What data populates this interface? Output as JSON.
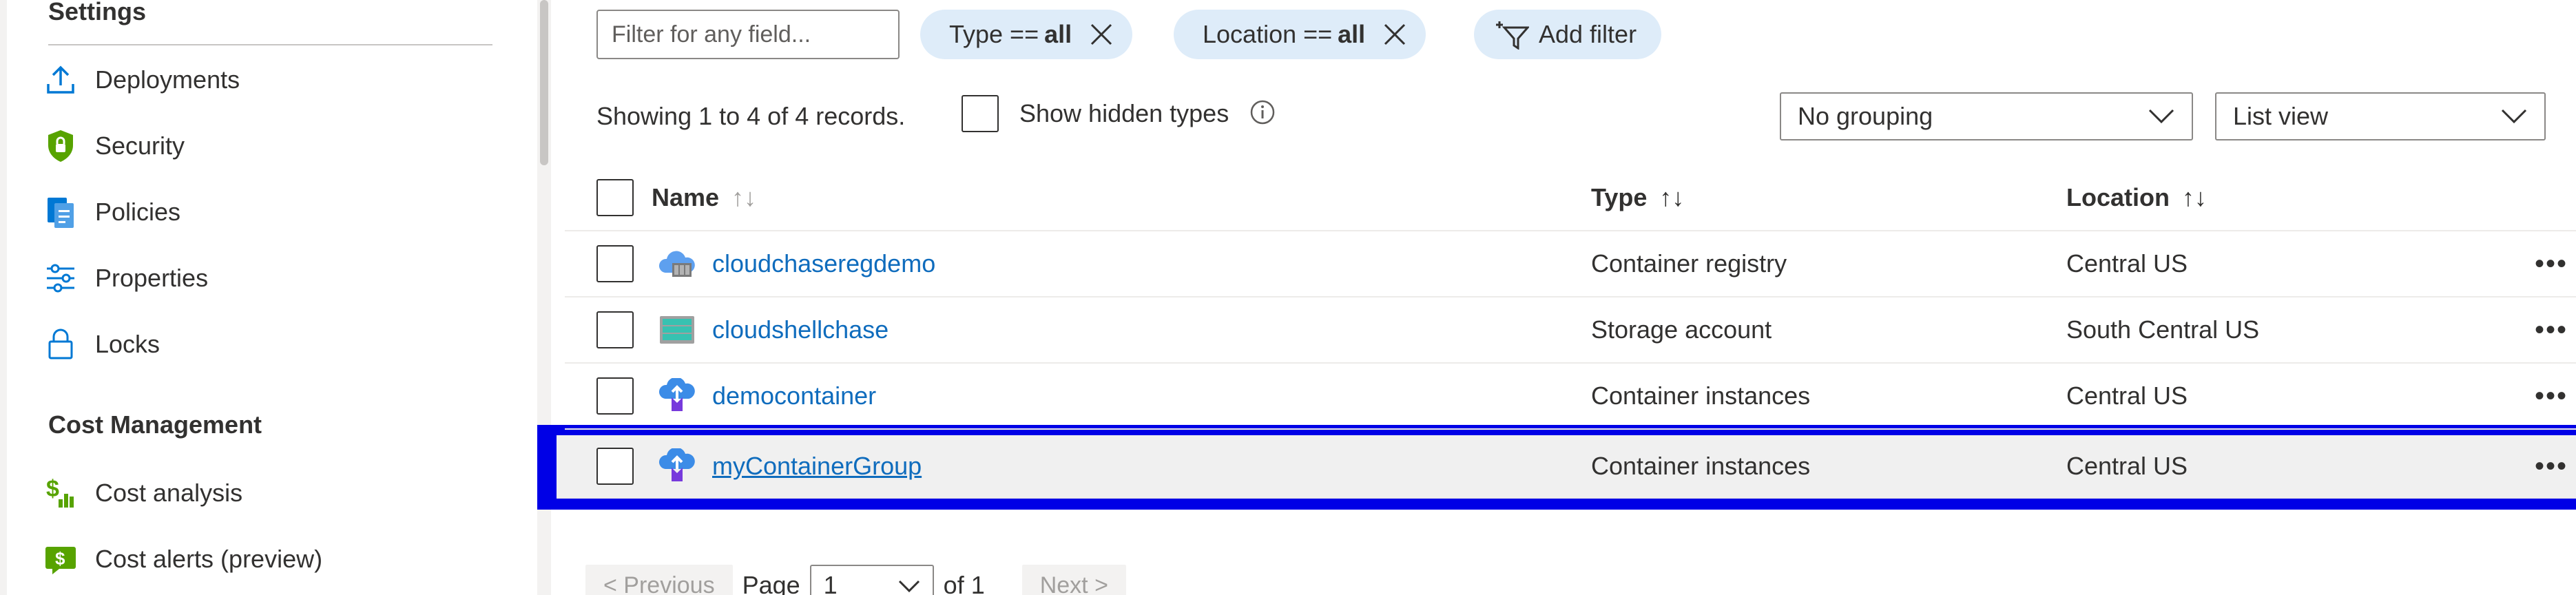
{
  "sidebar": {
    "settings_title": "Settings",
    "items": [
      {
        "label": "Deployments"
      },
      {
        "label": "Security"
      },
      {
        "label": "Policies"
      },
      {
        "label": "Properties"
      },
      {
        "label": "Locks"
      }
    ],
    "cost_title": "Cost Management",
    "cost_items": [
      {
        "label": "Cost analysis"
      },
      {
        "label": "Cost alerts (preview)"
      }
    ]
  },
  "toolbar": {
    "filter_placeholder": "Filter for any field...",
    "pill_type_prefix": "Type ==",
    "pill_type_value": "all",
    "pill_location_prefix": "Location ==",
    "pill_location_value": "all",
    "add_filter_label": "Add filter"
  },
  "records_text": "Showing 1 to 4 of 4 records.",
  "show_hidden_label": "Show hidden types",
  "grouping": {
    "selected": "No grouping"
  },
  "view": {
    "selected": "List view"
  },
  "table": {
    "headers": {
      "name": "Name",
      "type": "Type",
      "location": "Location"
    },
    "rows": [
      {
        "name": "cloudchaseregdemo",
        "type": "Container registry",
        "location": "Central US",
        "icon": "container-registry-icon"
      },
      {
        "name": "cloudshellchase",
        "type": "Storage account",
        "location": "South Central US",
        "icon": "storage-account-icon"
      },
      {
        "name": "democontainer",
        "type": "Container instances",
        "location": "Central US",
        "icon": "container-instances-icon"
      },
      {
        "name": "myContainerGroup",
        "type": "Container instances",
        "location": "Central US",
        "icon": "container-instances-icon"
      }
    ],
    "more_glyph": "•••"
  },
  "pagination": {
    "previous_label": "< Previous",
    "page_label": "Page",
    "page_value": "1",
    "of_label": "of 1",
    "next_label": "Next >"
  },
  "colors": {
    "accent": "#0f6cbd",
    "pill_bg": "#deecf9",
    "selection_band": "#0000e6",
    "security_green": "#57a300",
    "storage_teal": "#37c2b1"
  }
}
